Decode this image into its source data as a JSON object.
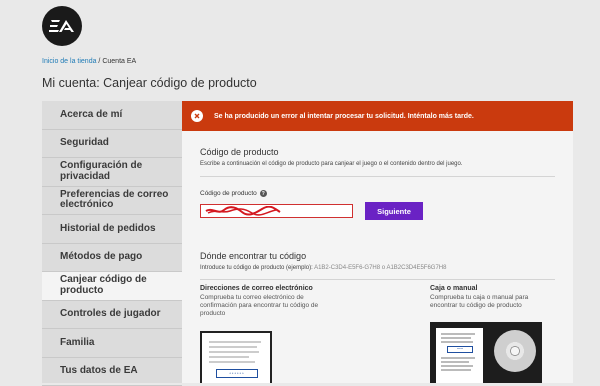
{
  "logo": {
    "text": "EA"
  },
  "breadcrumb": {
    "home": "Inicio de la tienda",
    "sep": " / ",
    "current": "Cuenta EA"
  },
  "page": {
    "title": "Mi cuenta: Canjear código de producto"
  },
  "sidebar": {
    "items": [
      {
        "label": "Acerca de mí"
      },
      {
        "label": "Seguridad"
      },
      {
        "label": "Configuración de privacidad"
      },
      {
        "label": "Preferencias de correo electrónico"
      },
      {
        "label": "Historial de pedidos"
      },
      {
        "label": "Métodos de pago"
      },
      {
        "label": "Canjear código de producto"
      },
      {
        "label": "Controles de jugador"
      },
      {
        "label": "Familia"
      },
      {
        "label": "Tus datos de EA"
      }
    ]
  },
  "error": {
    "message": "Se ha producido un error al intentar procesar tu solicitud. Inténtalo más tarde."
  },
  "redeem": {
    "heading": "Código de producto",
    "description": "Escribe a continuación el código de producto para canjear el juego o el contenido dentro del juego.",
    "field_label": "Código de producto",
    "field_value": "",
    "button": "Siguiente"
  },
  "where": {
    "heading": "Dónde encontrar tu código",
    "example_label": "Introduce tu código de producto (ejemplo):",
    "example_value": "A1B2-C3D4-E5F6-G7H8 o A1B2C3D4E5F6G7H8",
    "email_title": "Direcciones de correo electrónico",
    "email_text": "Comprueba tu correo electrónico de confirmación para encontrar tu código de producto",
    "box_title": "Caja o manual",
    "box_text": "Comprueba tu caja o manual para encontrar tu código de producto"
  },
  "colors": {
    "error": "#ca3a0e",
    "button": "#6a22c4",
    "link": "#1f7bb6"
  }
}
